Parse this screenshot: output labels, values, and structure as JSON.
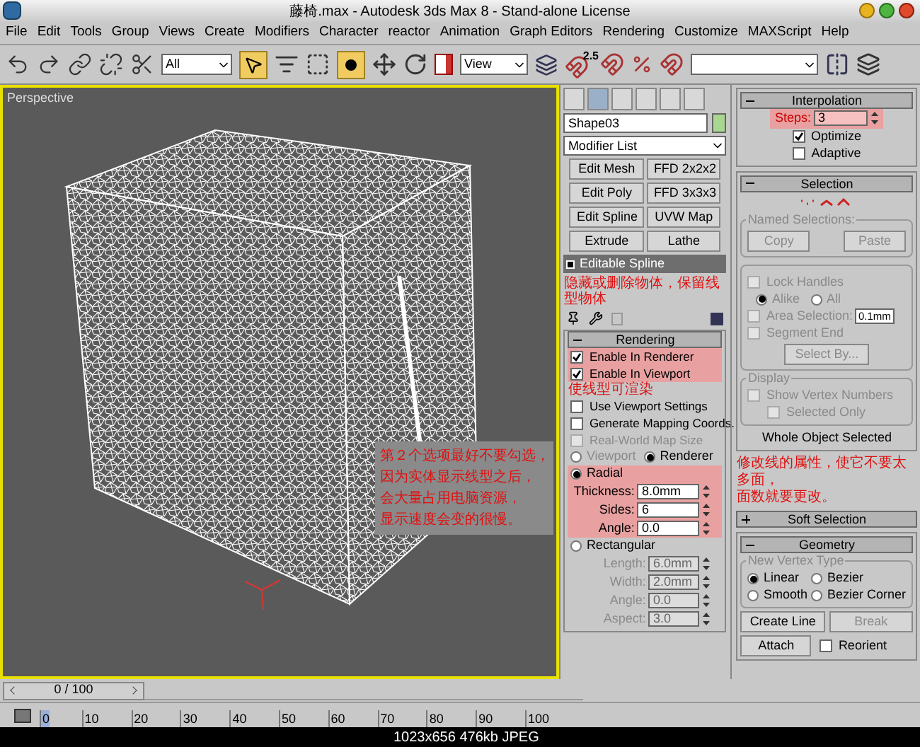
{
  "window": {
    "title": "藤椅.max - Autodesk 3ds Max 8  - Stand-alone License"
  },
  "menu": [
    "File",
    "Edit",
    "Tools",
    "Group",
    "Views",
    "Create",
    "Modifiers",
    "Character",
    "reactor",
    "Animation",
    "Graph Editors",
    "Rendering",
    "Customize",
    "MAXScript",
    "Help"
  ],
  "toolbar": {
    "selection_filter": "All",
    "reference_coord": "View",
    "snap_label": "2.5"
  },
  "viewport": {
    "label": "Perspective",
    "note": [
      "第２个选项最好不要勾选，",
      "因为实体显示线型之后，",
      "会大量占用电脑资源，",
      "显示速度会变的很慢。"
    ]
  },
  "command_panel": {
    "object_name": "Shape03",
    "modifier_list": "Modifier List",
    "modifier_buttons": [
      "Edit Mesh",
      "FFD 2x2x2",
      "Edit Poly",
      "FFD 3x3x3",
      "Edit Spline",
      "UVW Map",
      "Extrude",
      "Lathe"
    ],
    "stack": [
      {
        "label": "Editable Spline",
        "selected": true
      }
    ],
    "stack_note": "隐藏或删除物体，保留线型物体",
    "rendering": {
      "title": "Rendering",
      "expanded": true,
      "note": "使线型可渲染",
      "options": [
        {
          "label": "Enable In Renderer",
          "checked": true,
          "disabled": false
        },
        {
          "label": "Enable In Viewport",
          "checked": true,
          "disabled": false
        },
        {
          "label": "Use Viewport Settings",
          "checked": false,
          "disabled": false
        },
        {
          "label": "Generate Mapping Coords.",
          "checked": false,
          "disabled": false
        },
        {
          "label": "Real-World Map Size",
          "checked": false,
          "disabled": true
        }
      ],
      "display_mode": [
        {
          "label": "Viewport",
          "selected": false
        },
        {
          "label": "Renderer",
          "selected": true
        }
      ],
      "radial": {
        "label": "Radial",
        "selected": true,
        "fields": [
          {
            "label": "Thickness:",
            "value": "8.0mm"
          },
          {
            "label": "Sides:",
            "value": "6"
          },
          {
            "label": "Angle:",
            "value": "0.0"
          }
        ]
      },
      "rectangular": {
        "label": "Rectangular",
        "selected": false,
        "fields": [
          {
            "label": "Length:",
            "value": "6.0mm"
          },
          {
            "label": "Width:",
            "value": "2.0mm"
          },
          {
            "label": "Angle:",
            "value": "0.0"
          },
          {
            "label": "Aspect:",
            "value": "3.0"
          }
        ]
      }
    },
    "interpolation": {
      "title": "Interpolation",
      "expanded": true,
      "steps_label": "Steps:",
      "steps": "3",
      "options": [
        {
          "label": "Optimize",
          "checked": true
        },
        {
          "label": "Adaptive",
          "checked": false
        }
      ]
    },
    "selection": {
      "title": "Selection",
      "expanded": true,
      "controls_disabled": true,
      "named_selections": {
        "legend": "Named Selections:",
        "buttons": [
          "Copy",
          "Paste"
        ]
      },
      "lock_handles": {
        "label": "Lock Handles",
        "checked": false
      },
      "lock_mode": [
        {
          "label": "Alike",
          "selected": true
        },
        {
          "label": "All",
          "selected": false
        }
      ],
      "area_selection": {
        "label": "Area Selection:",
        "checked": false,
        "value": "0.1mm"
      },
      "segment_end": {
        "label": "Segment End",
        "checked": false
      },
      "select_by": "Select By...",
      "display": {
        "legend": "Display",
        "options": [
          {
            "label": "Show Vertex Numbers",
            "checked": false
          },
          {
            "label": "Selected Only",
            "checked": false
          }
        ]
      },
      "status": "Whole Object Selected"
    },
    "note": [
      "修改线的属性，使它不要太多面，",
      "面数就要更改。"
    ],
    "soft_selection": {
      "title": "Soft Selection",
      "expanded": false
    },
    "geometry": {
      "title": "Geometry",
      "expanded": true,
      "vertex_type": {
        "legend": "New Vertex Type",
        "options": [
          {
            "label": "Linear",
            "selected": true
          },
          {
            "label": "Bezier",
            "selected": false
          },
          {
            "label": "Smooth",
            "selected": false
          },
          {
            "label": "Bezier Corner",
            "selected": false
          }
        ]
      },
      "buttons": [
        {
          "label": "Create Line",
          "disabled": false
        },
        {
          "label": "Break",
          "disabled": true
        },
        {
          "label": "Attach",
          "disabled": false
        }
      ],
      "reorient": {
        "label": "Reorient",
        "checked": false
      }
    }
  },
  "timeline": {
    "position": "0 / 100",
    "level": 0,
    "ticks": [
      "0",
      "10",
      "20",
      "30",
      "40",
      "50",
      "60",
      "70",
      "80",
      "90",
      "100"
    ]
  },
  "image_info": "1023x656 476kb JPEG"
}
